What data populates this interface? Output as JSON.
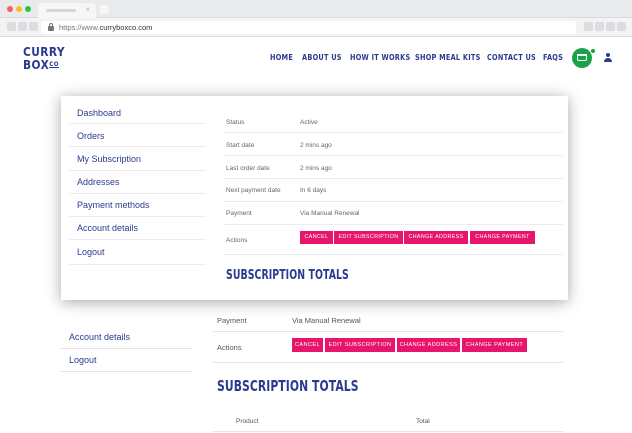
{
  "browser": {
    "url_prefix": "https://www.",
    "url_host": "curryboxco.com",
    "tab_close": "×"
  },
  "site": {
    "logo_line1": "CURRY",
    "logo_line2": "BOX",
    "logo_co": "CO",
    "nav": [
      "HOME",
      "ABOUT US",
      "HOW IT WORKS",
      "SHOP MEAL KITS",
      "CONTACT US",
      "FAQS"
    ]
  },
  "account_menu": {
    "items": [
      "Dashboard",
      "Orders",
      "My Subscription",
      "Addresses",
      "Payment methods",
      "Account details",
      "Logout"
    ]
  },
  "subscription": {
    "rows": [
      {
        "label": "Status",
        "value": "Active"
      },
      {
        "label": "Start date",
        "value": "2 mins ago"
      },
      {
        "label": "Last order date",
        "value": "2 mins ago"
      },
      {
        "label": "Next payment date",
        "value": "In 6 days"
      },
      {
        "label": "Payment",
        "value": "Via Manual Renewal"
      }
    ],
    "actions_label": "Actions",
    "actions": [
      "CANCEL",
      "EDIT SUBSCRIPTION",
      "CHANGE ADDRESS",
      "CHANGE PAYMENT"
    ],
    "totals_heading": "SUBSCRIPTION TOTALS"
  },
  "background_page": {
    "side_items": [
      "Account details",
      "Logout"
    ],
    "payment_label": "Payment",
    "payment_value": "Via Manual Renewal",
    "actions_label": "Actions",
    "actions": [
      "CANCEL",
      "EDIT SUBSCRIPTION",
      "CHANGE ADDRESS",
      "CHANGE PAYMENT"
    ],
    "totals_heading": "SUBSCRIPTION TOTALS",
    "table_headers": [
      "Product",
      "Total"
    ]
  },
  "colors": {
    "brand_blue": "#2a3b8f",
    "button_pink": "#e8166b",
    "cart_green": "#1aa24b"
  }
}
